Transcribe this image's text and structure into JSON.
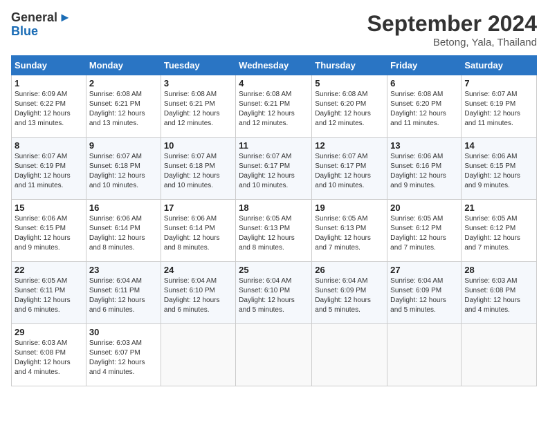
{
  "header": {
    "logo_line1": "General",
    "logo_line2": "Blue",
    "month": "September 2024",
    "location": "Betong, Yala, Thailand"
  },
  "columns": [
    "Sunday",
    "Monday",
    "Tuesday",
    "Wednesday",
    "Thursday",
    "Friday",
    "Saturday"
  ],
  "weeks": [
    [
      {
        "day": "1",
        "info": "Sunrise: 6:09 AM\nSunset: 6:22 PM\nDaylight: 12 hours\nand 13 minutes."
      },
      {
        "day": "2",
        "info": "Sunrise: 6:08 AM\nSunset: 6:21 PM\nDaylight: 12 hours\nand 13 minutes."
      },
      {
        "day": "3",
        "info": "Sunrise: 6:08 AM\nSunset: 6:21 PM\nDaylight: 12 hours\nand 12 minutes."
      },
      {
        "day": "4",
        "info": "Sunrise: 6:08 AM\nSunset: 6:21 PM\nDaylight: 12 hours\nand 12 minutes."
      },
      {
        "day": "5",
        "info": "Sunrise: 6:08 AM\nSunset: 6:20 PM\nDaylight: 12 hours\nand 12 minutes."
      },
      {
        "day": "6",
        "info": "Sunrise: 6:08 AM\nSunset: 6:20 PM\nDaylight: 12 hours\nand 11 minutes."
      },
      {
        "day": "7",
        "info": "Sunrise: 6:07 AM\nSunset: 6:19 PM\nDaylight: 12 hours\nand 11 minutes."
      }
    ],
    [
      {
        "day": "8",
        "info": "Sunrise: 6:07 AM\nSunset: 6:19 PM\nDaylight: 12 hours\nand 11 minutes."
      },
      {
        "day": "9",
        "info": "Sunrise: 6:07 AM\nSunset: 6:18 PM\nDaylight: 12 hours\nand 10 minutes."
      },
      {
        "day": "10",
        "info": "Sunrise: 6:07 AM\nSunset: 6:18 PM\nDaylight: 12 hours\nand 10 minutes."
      },
      {
        "day": "11",
        "info": "Sunrise: 6:07 AM\nSunset: 6:17 PM\nDaylight: 12 hours\nand 10 minutes."
      },
      {
        "day": "12",
        "info": "Sunrise: 6:07 AM\nSunset: 6:17 PM\nDaylight: 12 hours\nand 10 minutes."
      },
      {
        "day": "13",
        "info": "Sunrise: 6:06 AM\nSunset: 6:16 PM\nDaylight: 12 hours\nand 9 minutes."
      },
      {
        "day": "14",
        "info": "Sunrise: 6:06 AM\nSunset: 6:15 PM\nDaylight: 12 hours\nand 9 minutes."
      }
    ],
    [
      {
        "day": "15",
        "info": "Sunrise: 6:06 AM\nSunset: 6:15 PM\nDaylight: 12 hours\nand 9 minutes."
      },
      {
        "day": "16",
        "info": "Sunrise: 6:06 AM\nSunset: 6:14 PM\nDaylight: 12 hours\nand 8 minutes."
      },
      {
        "day": "17",
        "info": "Sunrise: 6:06 AM\nSunset: 6:14 PM\nDaylight: 12 hours\nand 8 minutes."
      },
      {
        "day": "18",
        "info": "Sunrise: 6:05 AM\nSunset: 6:13 PM\nDaylight: 12 hours\nand 8 minutes."
      },
      {
        "day": "19",
        "info": "Sunrise: 6:05 AM\nSunset: 6:13 PM\nDaylight: 12 hours\nand 7 minutes."
      },
      {
        "day": "20",
        "info": "Sunrise: 6:05 AM\nSunset: 6:12 PM\nDaylight: 12 hours\nand 7 minutes."
      },
      {
        "day": "21",
        "info": "Sunrise: 6:05 AM\nSunset: 6:12 PM\nDaylight: 12 hours\nand 7 minutes."
      }
    ],
    [
      {
        "day": "22",
        "info": "Sunrise: 6:05 AM\nSunset: 6:11 PM\nDaylight: 12 hours\nand 6 minutes."
      },
      {
        "day": "23",
        "info": "Sunrise: 6:04 AM\nSunset: 6:11 PM\nDaylight: 12 hours\nand 6 minutes."
      },
      {
        "day": "24",
        "info": "Sunrise: 6:04 AM\nSunset: 6:10 PM\nDaylight: 12 hours\nand 6 minutes."
      },
      {
        "day": "25",
        "info": "Sunrise: 6:04 AM\nSunset: 6:10 PM\nDaylight: 12 hours\nand 5 minutes."
      },
      {
        "day": "26",
        "info": "Sunrise: 6:04 AM\nSunset: 6:09 PM\nDaylight: 12 hours\nand 5 minutes."
      },
      {
        "day": "27",
        "info": "Sunrise: 6:04 AM\nSunset: 6:09 PM\nDaylight: 12 hours\nand 5 minutes."
      },
      {
        "day": "28",
        "info": "Sunrise: 6:03 AM\nSunset: 6:08 PM\nDaylight: 12 hours\nand 4 minutes."
      }
    ],
    [
      {
        "day": "29",
        "info": "Sunrise: 6:03 AM\nSunset: 6:08 PM\nDaylight: 12 hours\nand 4 minutes."
      },
      {
        "day": "30",
        "info": "Sunrise: 6:03 AM\nSunset: 6:07 PM\nDaylight: 12 hours\nand 4 minutes."
      },
      {
        "day": "",
        "info": ""
      },
      {
        "day": "",
        "info": ""
      },
      {
        "day": "",
        "info": ""
      },
      {
        "day": "",
        "info": ""
      },
      {
        "day": "",
        "info": ""
      }
    ]
  ]
}
